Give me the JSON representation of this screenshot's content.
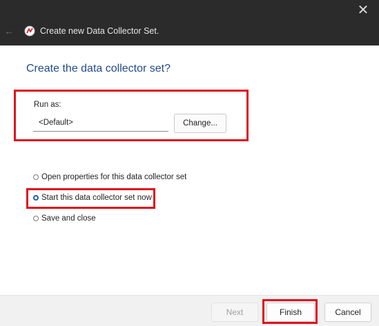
{
  "window": {
    "title": "Create new Data Collector Set.",
    "close_icon": "close-icon",
    "back_icon": "back-arrow-icon",
    "app_icon": "performance-monitor-icon"
  },
  "wizard": {
    "heading": "Create the data collector set?",
    "run_as": {
      "label": "Run as:",
      "value": "<Default>",
      "change_button": "Change..."
    },
    "options": [
      {
        "label": "Open properties for this data collector set",
        "selected": false
      },
      {
        "label": "Start this data collector set now",
        "selected": true
      },
      {
        "label": "Save and close",
        "selected": false
      }
    ]
  },
  "footer": {
    "next": "Next",
    "next_enabled": false,
    "finish": "Finish",
    "cancel": "Cancel"
  },
  "highlight_color": "#e0101c",
  "accent_color": "#1f4a8c"
}
